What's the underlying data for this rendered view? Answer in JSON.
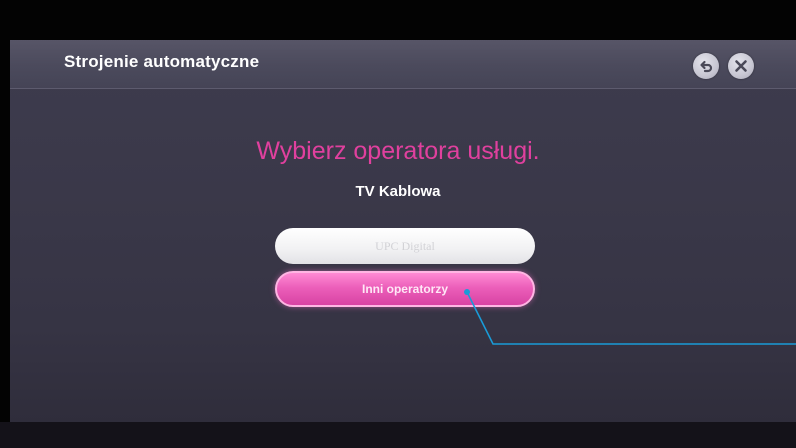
{
  "window": {
    "title": "Strojenie automatyczne"
  },
  "controls": {
    "back_icon": "back-arrow-icon",
    "close_icon": "close-icon"
  },
  "main": {
    "heading": "Wybierz operatora usługi.",
    "subheading": "TV Kablowa",
    "options": [
      {
        "label": "UPC Digital",
        "selected": false
      },
      {
        "label": "Inni operatorzy",
        "selected": true
      }
    ]
  },
  "colors": {
    "accent_pink": "#e0409e",
    "selected_button": "#ec5fba",
    "annotation_line": "#1a9bd7"
  }
}
